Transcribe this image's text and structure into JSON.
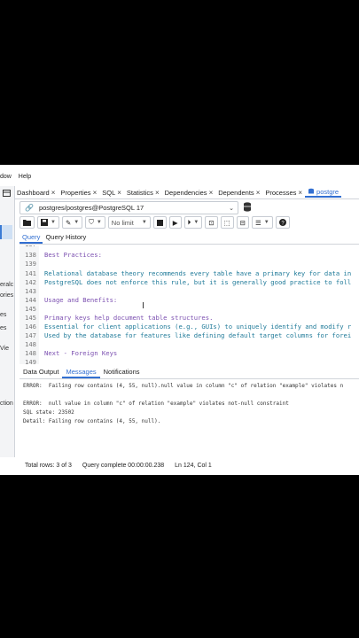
{
  "menu": [
    "dow",
    "Help"
  ],
  "left_panel": [
    "eralc",
    "ories",
    "es",
    "es",
    "Vie",
    "ction"
  ],
  "tabs": [
    {
      "label": "Dashboard"
    },
    {
      "label": "Properties"
    },
    {
      "label": "SQL"
    },
    {
      "label": "Statistics"
    },
    {
      "label": "Dependencies"
    },
    {
      "label": "Dependents"
    },
    {
      "label": "Processes"
    },
    {
      "label": "postgre"
    }
  ],
  "connection": {
    "label": "postgres/postgres@PostgreSQL 17"
  },
  "toolbar": {
    "limit": "No limit"
  },
  "query_tabs": [
    "Query",
    "Query History"
  ],
  "editor": {
    "lines": [
      {
        "n": "137",
        "text": ""
      },
      {
        "n": "138",
        "text": "Best Practices:"
      },
      {
        "n": "139",
        "text": ""
      },
      {
        "n": "141",
        "text": "Relational database theory recommends every table have a primary key for data in"
      },
      {
        "n": "142",
        "text": "PostgreSQL does not enforce this rule, but it is generally good practice to foll"
      },
      {
        "n": "143",
        "text": ""
      },
      {
        "n": "144",
        "text": "Usage and Benefits:"
      },
      {
        "n": "145",
        "text": ""
      },
      {
        "n": "145",
        "text": "Primary keys help document table structures."
      },
      {
        "n": "146",
        "text": "Essential for client applications (e.g., GUIs) to uniquely identify and modify r"
      },
      {
        "n": "147",
        "text": "Used by the database for features like defining default target columns for forei"
      },
      {
        "n": "148",
        "text": ""
      },
      {
        "n": "148",
        "text": "Next - Foreign Keys"
      },
      {
        "n": "149",
        "text": ""
      }
    ]
  },
  "output_tabs": [
    "Data Output",
    "Messages",
    "Notifications"
  ],
  "messages": [
    "ERROR:  Failing row contains (4, 55, null).null value in column \"c\" of relation \"example\" violates n",
    "",
    "ERROR:  null value in column \"c\" of relation \"example\" violates not-null constraint",
    "SQL state: 23502",
    "Detail: Failing row contains (4, 55, null)."
  ],
  "status": {
    "rows": "Total rows: 3 of 3",
    "query": "Query complete 00:00:00.238",
    "pos": "Ln 124, Col 1"
  },
  "colors": {
    "accent": "#326fd1",
    "comment": "#1f7a99"
  }
}
